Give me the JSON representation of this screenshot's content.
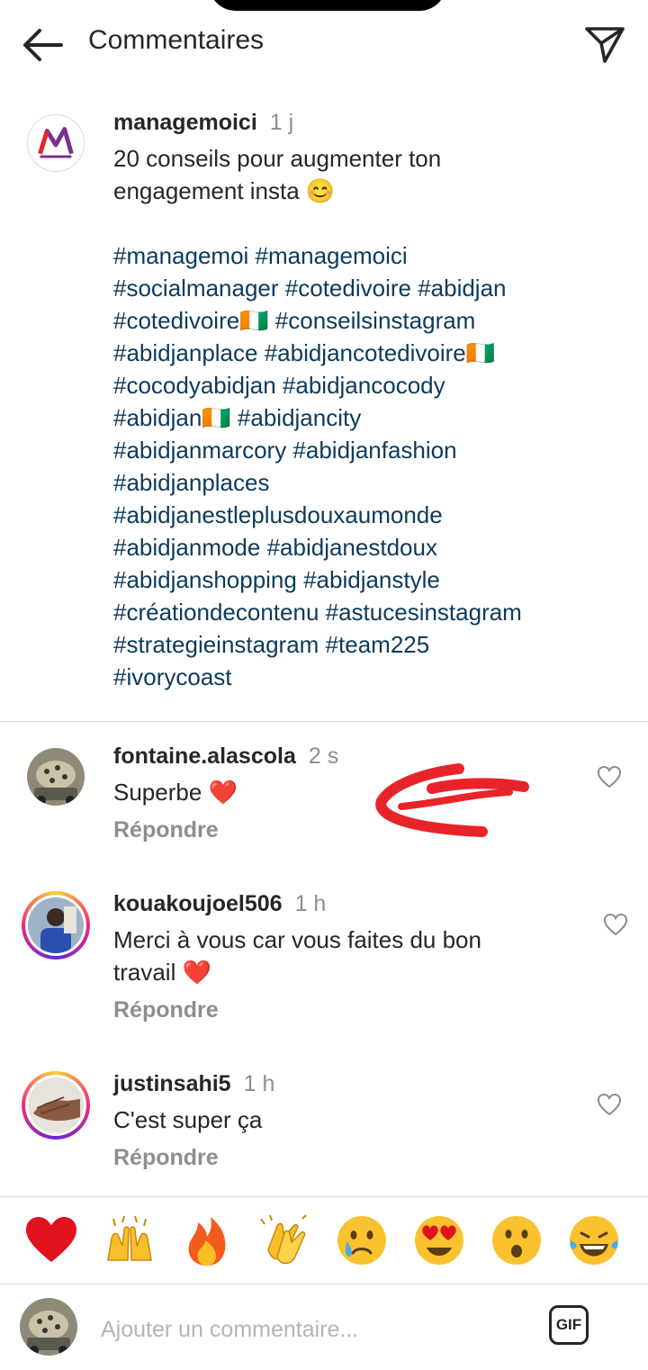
{
  "header": {
    "title": "Commentaires"
  },
  "post": {
    "username": "managemoici",
    "time": "1 j",
    "text_line1": "20 conseils pour augmenter ton",
    "text_line2": "engagement insta 😊",
    "hashtags": [
      "#managemoi #managemoici",
      "#socialmanager #cotedivoire #abidjan",
      "#cotedivoire🇨🇮 #conseilsinstagram",
      "#abidjanplace #abidjancotedivoire🇨🇮",
      "#cocodyabidjan #abidjancocody",
      "#abidjan🇨🇮 #abidjancity",
      "#abidjanmarcory #abidjanfashion",
      "#abidjanplaces",
      "#abidjanestleplusdouxaumonde",
      "#abidjanmode #abidjanestdoux",
      "#abidjanshopping #abidjanstyle",
      "#créationdecontenu #astucesinstagram",
      "#strategieinstagram #team225",
      "#ivorycoast"
    ]
  },
  "comments": [
    {
      "username": "fontaine.alascola",
      "time": "2 s",
      "text": "Superbe ❤️",
      "reply": "Répondre"
    },
    {
      "username": "kouakoujoel506",
      "time": "1 h",
      "text_line1": "Merci à vous car vous faites du bon",
      "text_line2": "travail ❤️",
      "reply": "Répondre"
    },
    {
      "username": "justinsahi5",
      "time": "1 h",
      "text": "C'est super ça",
      "reply": "Répondre"
    }
  ],
  "reactions": [
    "heart-emoji",
    "raising-hands-emoji",
    "fire-emoji",
    "clapping-hands-emoji",
    "crying-face-emoji",
    "heart-eyes-emoji",
    "surprised-face-emoji",
    "tears-of-joy-emoji"
  ],
  "composer": {
    "placeholder": "Ajouter un commentaire...",
    "gif_label": "GIF"
  },
  "colors": {
    "hashtag": "#0c3a5c",
    "muted": "#8e8e8e",
    "annotation": "#e8242a",
    "heart": "#e0131c"
  }
}
